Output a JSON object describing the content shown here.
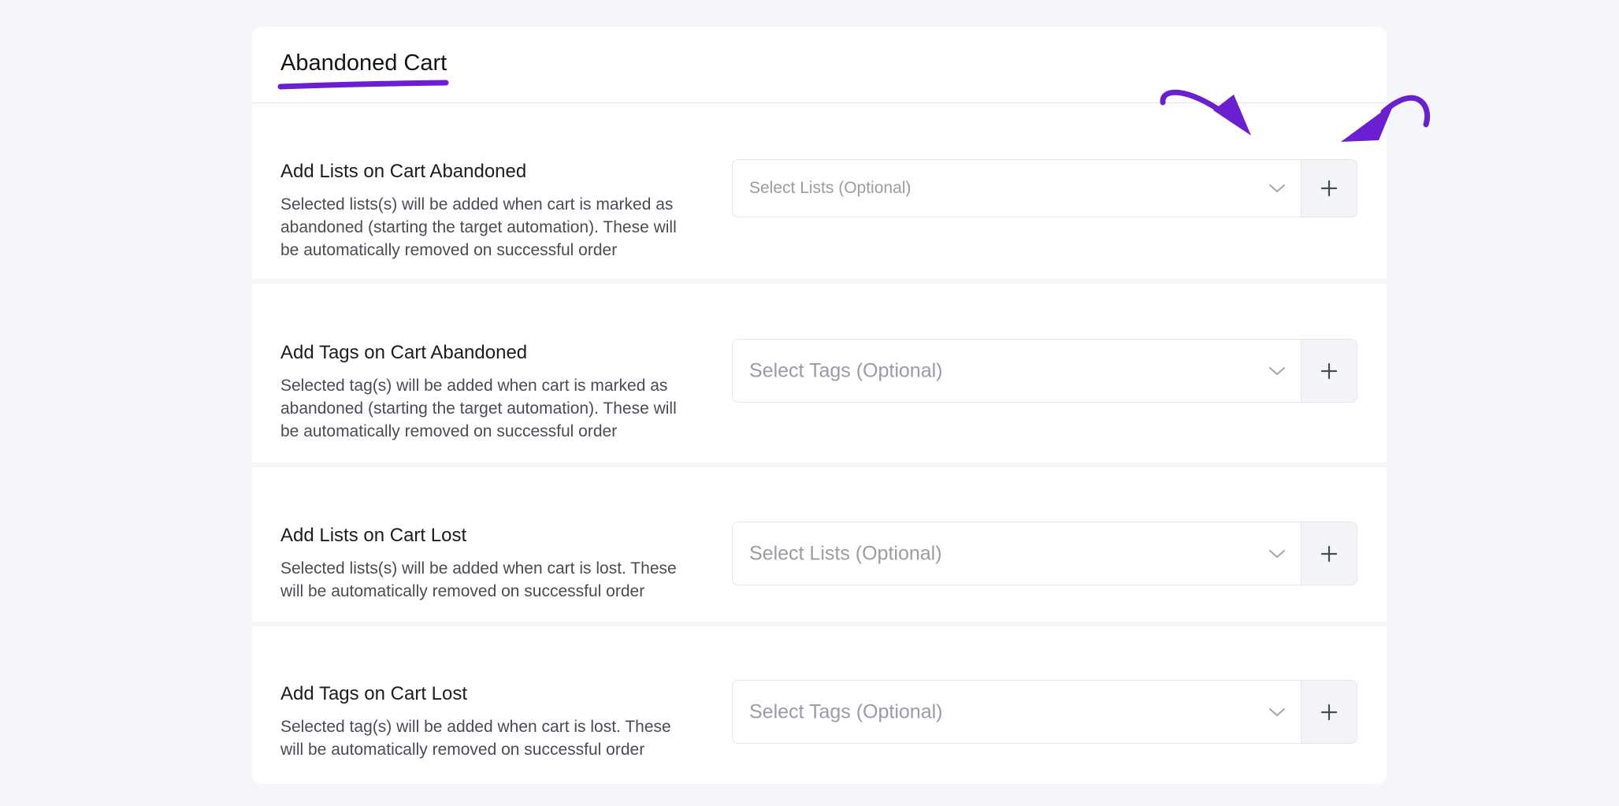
{
  "card": {
    "title": "Abandoned Cart"
  },
  "rows": [
    {
      "title": "Add Lists on Cart Abandoned",
      "description": "Selected lists(s) will be added when cart is marked as abandoned (starting the target automation). These will be automatically removed on successful order",
      "placeholder": "Select Lists (Optional)"
    },
    {
      "title": "Add Tags on Cart Abandoned",
      "description": "Selected tag(s) will be added when cart is marked as abandoned (starting the target automation). These will be automatically removed on successful order",
      "placeholder": "Select Tags (Optional)"
    },
    {
      "title": "Add Lists on Cart Lost",
      "description": "Selected lists(s) will be added when cart is lost. These will be automatically removed on successful order",
      "placeholder": "Select Lists (Optional)"
    },
    {
      "title": "Add Tags on Cart Lost",
      "description": "Selected tag(s) will be added when cart is lost. These will be automatically removed on successful order",
      "placeholder": "Select Tags (Optional)"
    }
  ],
  "icons": {
    "chevron": "chevron-down-icon",
    "add": "plus-icon",
    "annotation": "arrow-annotation-icon"
  },
  "colors": {
    "accent": "#6a1fd1",
    "background": "#f5f6fa",
    "card": "#ffffff",
    "border": "#e3e5ea",
    "placeholder": "#9a9ca5"
  }
}
